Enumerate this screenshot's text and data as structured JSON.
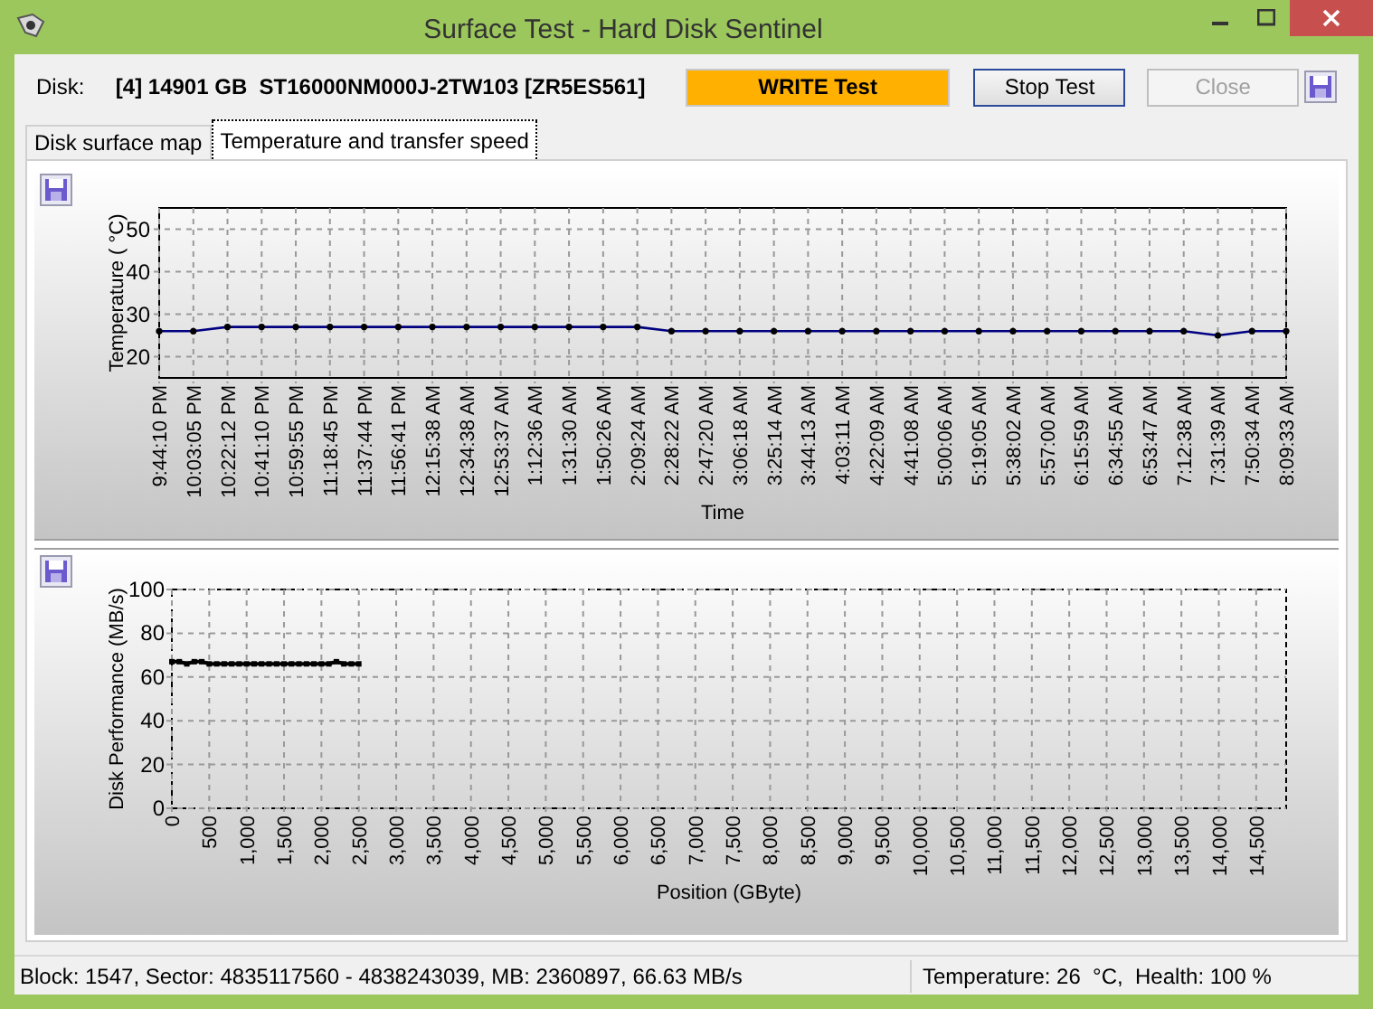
{
  "window": {
    "title": "Surface Test - Hard Disk Sentinel"
  },
  "disk": {
    "label": "Disk:",
    "name": "[4] 14901 GB  ST16000NM000J-2TW103 [ZR5ES561]"
  },
  "status_box": "WRITE Test",
  "buttons": [
    {
      "label": "Stop Test",
      "disabled": false
    },
    {
      "label": "Close",
      "disabled": true
    }
  ],
  "tabs": [
    {
      "label": "Disk surface map",
      "selected": false
    },
    {
      "label": "Temperature and transfer speed",
      "selected": true
    }
  ],
  "temperature_chart": {
    "chart_data": {
      "type": "line",
      "xlabel": "Time",
      "ylabel": "Temperature ( °C)",
      "categories": [
        "9:44:10 PM",
        "10:03:05 PM",
        "10:22:12 PM",
        "10:41:10 PM",
        "10:59:55 PM",
        "11:18:45 PM",
        "11:37:44 PM",
        "11:56:41 PM",
        "12:15:38 AM",
        "12:34:38 AM",
        "12:53:37 AM",
        "1:12:36 AM",
        "1:31:30 AM",
        "1:50:26 AM",
        "2:09:24 AM",
        "2:28:22 AM",
        "2:47:20 AM",
        "3:06:18 AM",
        "3:25:14 AM",
        "3:44:13 AM",
        "4:03:11 AM",
        "4:22:09 AM",
        "4:41:08 AM",
        "5:00:06 AM",
        "5:19:05 AM",
        "5:38:02 AM",
        "5:57:00 AM",
        "6:15:59 AM",
        "6:34:55 AM",
        "6:53:47 AM",
        "7:12:38 AM",
        "7:31:39 AM",
        "7:50:34 AM",
        "8:09:33 AM"
      ],
      "grid": true,
      "series": [
        {
          "color": "#000080",
          "marker": "circle",
          "values": [
            26,
            26,
            27,
            27,
            27,
            27,
            27,
            27,
            27,
            27,
            27,
            27,
            27,
            27,
            27,
            26,
            26,
            26,
            26,
            26,
            26,
            26,
            26,
            26,
            26,
            26,
            26,
            26,
            26,
            26,
            26,
            25,
            26,
            26
          ]
        }
      ],
      "ylim": [
        15,
        55
      ],
      "yticks": [
        20,
        30,
        40,
        50
      ]
    }
  },
  "performance_chart": {
    "chart_data": {
      "type": "line",
      "xlabel": "Position (GByte)",
      "ylabel": "Disk Performance (MB/s)",
      "x": [
        0,
        100,
        200,
        300,
        400,
        500,
        600,
        700,
        800,
        900,
        1000,
        1100,
        1200,
        1300,
        1400,
        1500,
        1600,
        1700,
        1800,
        1900,
        2000,
        2100,
        2200,
        2300,
        2400,
        2500
      ],
      "grid": true,
      "series": [
        {
          "color": "#000000",
          "marker": "square",
          "values": [
            67,
            67,
            66,
            67,
            67,
            66,
            66,
            66,
            66,
            66,
            66,
            66,
            66,
            66,
            66,
            66,
            66,
            66,
            66,
            66,
            66,
            66,
            67,
            66,
            66,
            66
          ]
        }
      ],
      "xlim": [
        0,
        14901
      ],
      "ylim": [
        0,
        100
      ],
      "xticks": [
        0,
        500,
        {
          "value": 1000,
          "label": "1,000"
        },
        {
          "value": 1500,
          "label": "1,500"
        },
        {
          "value": 2000,
          "label": "2,000"
        },
        {
          "value": 2500,
          "label": "2,500"
        },
        {
          "value": 3000,
          "label": "3,000"
        },
        {
          "value": 3500,
          "label": "3,500"
        },
        {
          "value": 4000,
          "label": "4,000"
        },
        {
          "value": 4500,
          "label": "4,500"
        },
        {
          "value": 5000,
          "label": "5,000"
        },
        {
          "value": 5500,
          "label": "5,500"
        },
        {
          "value": 6000,
          "label": "6,000"
        },
        {
          "value": 6500,
          "label": "6,500"
        },
        {
          "value": 7000,
          "label": "7,000"
        },
        {
          "value": 7500,
          "label": "7,500"
        },
        {
          "value": 8000,
          "label": "8,000"
        },
        {
          "value": 8500,
          "label": "8,500"
        },
        {
          "value": 9000,
          "label": "9,000"
        },
        {
          "value": 9500,
          "label": "9,500"
        },
        {
          "value": 10000,
          "label": "10,000"
        },
        {
          "value": 10500,
          "label": "10,500"
        },
        {
          "value": 11000,
          "label": "11,000"
        },
        {
          "value": 11500,
          "label": "11,500"
        },
        {
          "value": 12000,
          "label": "12,000"
        },
        {
          "value": 12500,
          "label": "12,500"
        },
        {
          "value": 13000,
          "label": "13,000"
        },
        {
          "value": 13500,
          "label": "13,500"
        },
        {
          "value": 14000,
          "label": "14,000"
        },
        {
          "value": 14500,
          "label": "14,500"
        }
      ],
      "yticks": [
        0,
        20,
        40,
        60,
        80,
        100
      ]
    }
  },
  "status_bar": {
    "left": "Block: 1547, Sector: 4835117560 - 4838243039, MB: 2360897, 66.63 MB/s",
    "right": "Temperature: 26  °C,  Health: 100 %"
  }
}
